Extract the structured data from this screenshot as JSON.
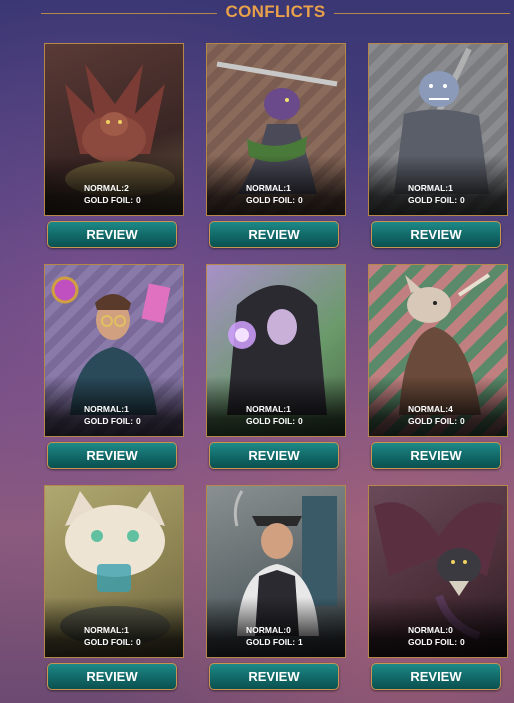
{
  "header": {
    "title": "CONFLICTS"
  },
  "labels": {
    "normal": "NORMAL:",
    "gold_foil": "GOLD FOIL:",
    "review": "REVIEW"
  },
  "cards": [
    {
      "subject": "dragon-icon",
      "bg": "#4a3030",
      "normal": "2",
      "gold_foil": "0"
    },
    {
      "subject": "lizard-warrior-icon",
      "bg": "#6b5a4e",
      "normal": "1",
      "gold_foil": "0"
    },
    {
      "subject": "ogre-warrior-icon",
      "bg": "#5e6064",
      "normal": "1",
      "gold_foil": "0"
    },
    {
      "subject": "gentleman-mage-icon",
      "bg": "#6a5a88",
      "normal": "1",
      "gold_foil": "0"
    },
    {
      "subject": "hooded-sorcerer-icon",
      "bg": "#7c8a6a",
      "normal": "1",
      "gold_foil": "0"
    },
    {
      "subject": "rat-rogue-icon",
      "bg": "#6e7a68",
      "normal": "4",
      "gold_foil": "0"
    },
    {
      "subject": "cat-icon",
      "bg": "#8a8a5a",
      "normal": "1",
      "gold_foil": "0"
    },
    {
      "subject": "bartender-icon",
      "bg": "#6a7478",
      "normal": "0",
      "gold_foil": "1"
    },
    {
      "subject": "bat-dragon-icon",
      "bg": "#5a3a44",
      "normal": "0",
      "gold_foil": "0"
    }
  ]
}
